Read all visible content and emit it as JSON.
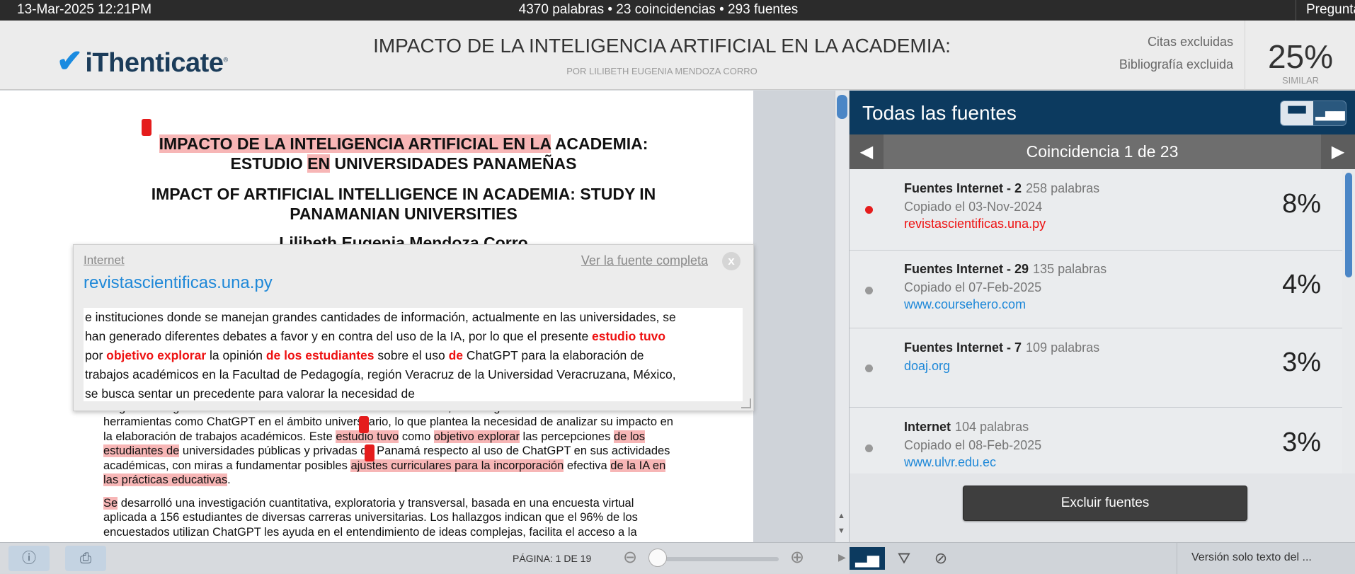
{
  "topbar": {
    "datetime": "13-Mar-2025 12:21PM",
    "stats": "4370 palabras • 23 coincidencias • 293 fuentes",
    "questions": "Preguntas"
  },
  "header": {
    "logo": "iThenticate",
    "title": "IMPACTO DE LA INTELIGENCIA ARTIFICIAL EN LA ACADEMIA:",
    "author": "POR LILIBETH EUGENIA MENDOZA CORRO",
    "excluded_citations": "Citas excluidas",
    "excluded_bibliography": "Bibliografía excluida",
    "score": "25%",
    "score_label": "SIMILAR"
  },
  "document": {
    "title_hl1": "IMPACTO DE LA INTELIGENCIA ARTIFICIAL EN LA",
    "title_rest1": " ACADEMIA:",
    "title_l2a": "ESTUDIO ",
    "title_l2hl": "EN",
    "title_l2b": " UNIVERSIDADES PANAMEÑAS",
    "en_title_l1": "IMPACT OF ARTIFICIAL INTELLIGENCE IN ACADEMIA: STUDY IN",
    "en_title_l2": "PANAMANIAN UNIVERSITIES",
    "author": "Lilibeth Eugenia Mendoza Corro",
    "p1": {
      "l0": "se gestionan grandes volúmenes de información. En este contexto, han surgido debates en torno al uso de",
      "l1a": "herramientas como ChatGPT en el ámbito universitario, lo que plantea la necesidad de analizar su impacto en",
      "l2a": "la elaboración de trabajos académicos. Este ",
      "l2hl1": "estudio tuvo",
      "l2b": " como ",
      "l2hl2": "objetivo explorar",
      "l2c": " las percepciones ",
      "l2hl3": "de los",
      "l3hl": "estudiantes de",
      "l3b": " universidades públicas y privadas de Panamá respecto al uso de ChatGPT en sus actividades",
      "l4a": "académicas, con miras a fundamentar posibles ",
      "l4hl1": "ajustes curriculares para la incorporación",
      "l4b": " efectiva ",
      "l4hl2": "de la IA en",
      "l5hl": "las prácticas educativas",
      "l5b": "."
    },
    "p2": {
      "l1hl": "Se",
      "l1b": " desarrolló una investigación cuantitativa, exploratoria y transversal, basada en una encuesta virtual",
      "l2": "aplicada a 156 estudiantes de diversas carreras universitarias. Los hallazgos indican que el 96% de los",
      "l3": "encuestados utilizan ChatGPT les ayuda en el entendimiento de ideas complejas, facilita el acceso a la"
    }
  },
  "popup": {
    "type": "Internet",
    "full_source_link": "Ver la fuente completa",
    "close": "x",
    "source": "revistascientificas.una.py",
    "text_l1": "e instituciones donde se manejan grandes cantidades de información, actualmente en las universidades, se",
    "text_l2a": "han generado diferentes debates a favor y en contra del uso de la IA, por lo que el presente ",
    "text_l2red": "estudio tuvo",
    "text_l3a": "por ",
    "text_l3red1": "objetivo explorar",
    "text_l3b": " la opinión ",
    "text_l3red2": "de los estudiantes",
    "text_l3c": " sobre el uso ",
    "text_l3red3": "de",
    "text_l3d": " ChatGPT para la elaboración de",
    "text_l4": "trabajos académicos en la Facultad de Pedagogía, región Veracruz de la Universidad Veracruzana, México,",
    "text_l5": "se busca sentar un precedente para valorar la necesidad de"
  },
  "panel": {
    "title": "Todas las fuentes",
    "match_label": "Coincidencia 1 de 23",
    "sources": [
      {
        "name": "Fuentes Internet - 2",
        "words": "258 palabras",
        "copied": "Copiado el 03-Nov-2024",
        "url": "revistascientificas.una.py",
        "pct": "8%"
      },
      {
        "name": "Fuentes Internet - 29",
        "words": "135 palabras",
        "copied": "Copiado el 07-Feb-2025",
        "url": "www.coursehero.com",
        "pct": "4%"
      },
      {
        "name": "Fuentes Internet - 7",
        "words": "109 palabras",
        "copied": "",
        "url": "doaj.org",
        "pct": "3%"
      },
      {
        "name": "Internet",
        "words": "104 palabras",
        "copied": "Copiado el 08-Feb-2025",
        "url": "www.ulvr.edu.ec",
        "pct": "3%"
      }
    ],
    "exclude_button": "Excluir fuentes"
  },
  "bottom": {
    "page_info": "PÁGINA: 1 DE 19",
    "text_only": "Versión solo texto del ..."
  },
  "colors": {
    "highlight": "#f7b6b6",
    "match_red": "#e51c1c",
    "panel_header": "#0c3a5f",
    "link_blue": "#1e88d8"
  },
  "icons": [
    "info-icon",
    "print-icon",
    "zoom-out-icon",
    "zoom-in-icon",
    "chart-icon",
    "filter-icon",
    "exclude-icon",
    "list-view-icon",
    "bar-view-icon"
  ]
}
